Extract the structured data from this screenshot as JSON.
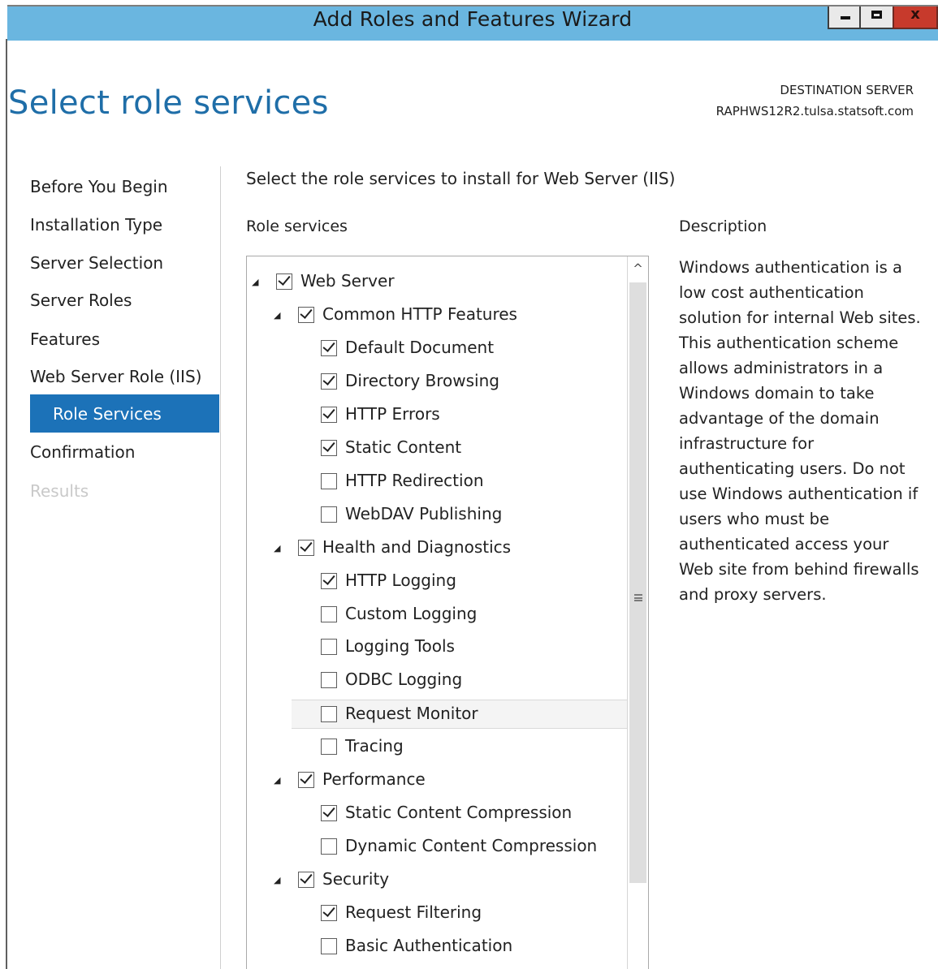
{
  "window": {
    "title": "Add Roles and Features Wizard",
    "minimize_icon": "minimize-icon",
    "maximize_icon": "maximize-icon",
    "close_glyph": "x",
    "titlebar_color": "#6ab6e0",
    "close_color": "#c73a2c"
  },
  "header": {
    "page_title": "Select role services",
    "destination_label": "DESTINATION SERVER",
    "destination_server": "RAPHWS12R2.tulsa.statsoft.com"
  },
  "nav": {
    "items": [
      {
        "label": "Before You Begin",
        "state": "normal"
      },
      {
        "label": "Installation Type",
        "state": "normal"
      },
      {
        "label": "Server Selection",
        "state": "normal"
      },
      {
        "label": "Server Roles",
        "state": "normal"
      },
      {
        "label": "Features",
        "state": "normal"
      },
      {
        "label": "Web Server Role (IIS)",
        "state": "normal"
      },
      {
        "label": "Role Services",
        "state": "selected"
      },
      {
        "label": "Confirmation",
        "state": "normal"
      },
      {
        "label": "Results",
        "state": "disabled"
      }
    ],
    "selected_color": "#1c72b8"
  },
  "main": {
    "instruction": "Select the role services to install for Web Server (IIS)",
    "role_services_label": "Role services",
    "description_label": "Description",
    "description_text": "Windows authentication is a low cost authentication solution for internal Web sites. This authentication scheme allows administrators in a Windows domain to take advantage of the domain infrastructure for authenticating users. Do not use Windows authentication if users who must be authenticated access your Web site from behind firewalls and proxy servers."
  },
  "tree": {
    "items": [
      {
        "label": "Web Server",
        "level": 0,
        "checked": true,
        "expandable": true,
        "highlighted": false
      },
      {
        "label": "Common HTTP Features",
        "level": 1,
        "checked": true,
        "expandable": true,
        "highlighted": false
      },
      {
        "label": "Default Document",
        "level": 2,
        "checked": true,
        "expandable": false,
        "highlighted": false
      },
      {
        "label": "Directory Browsing",
        "level": 2,
        "checked": true,
        "expandable": false,
        "highlighted": false
      },
      {
        "label": "HTTP Errors",
        "level": 2,
        "checked": true,
        "expandable": false,
        "highlighted": false
      },
      {
        "label": "Static Content",
        "level": 2,
        "checked": true,
        "expandable": false,
        "highlighted": false
      },
      {
        "label": "HTTP Redirection",
        "level": 2,
        "checked": false,
        "expandable": false,
        "highlighted": false
      },
      {
        "label": "WebDAV Publishing",
        "level": 2,
        "checked": false,
        "expandable": false,
        "highlighted": false
      },
      {
        "label": "Health and Diagnostics",
        "level": 1,
        "checked": true,
        "expandable": true,
        "highlighted": false
      },
      {
        "label": "HTTP Logging",
        "level": 2,
        "checked": true,
        "expandable": false,
        "highlighted": false
      },
      {
        "label": "Custom Logging",
        "level": 2,
        "checked": false,
        "expandable": false,
        "highlighted": false
      },
      {
        "label": "Logging Tools",
        "level": 2,
        "checked": false,
        "expandable": false,
        "highlighted": false
      },
      {
        "label": "ODBC Logging",
        "level": 2,
        "checked": false,
        "expandable": false,
        "highlighted": false
      },
      {
        "label": "Request Monitor",
        "level": 2,
        "checked": false,
        "expandable": false,
        "highlighted": true
      },
      {
        "label": "Tracing",
        "level": 2,
        "checked": false,
        "expandable": false,
        "highlighted": false
      },
      {
        "label": "Performance",
        "level": 1,
        "checked": true,
        "expandable": true,
        "highlighted": false
      },
      {
        "label": "Static Content Compression",
        "level": 2,
        "checked": true,
        "expandable": false,
        "highlighted": false
      },
      {
        "label": "Dynamic Content Compression",
        "level": 2,
        "checked": false,
        "expandable": false,
        "highlighted": false
      },
      {
        "label": "Security",
        "level": 1,
        "checked": true,
        "expandable": true,
        "highlighted": false
      },
      {
        "label": "Request Filtering",
        "level": 2,
        "checked": true,
        "expandable": false,
        "highlighted": false
      },
      {
        "label": "Basic Authentication",
        "level": 2,
        "checked": false,
        "expandable": false,
        "highlighted": false
      }
    ],
    "scroll_up_icon": "chevron-up-icon",
    "grip_icon": "scroll-grip-icon"
  }
}
